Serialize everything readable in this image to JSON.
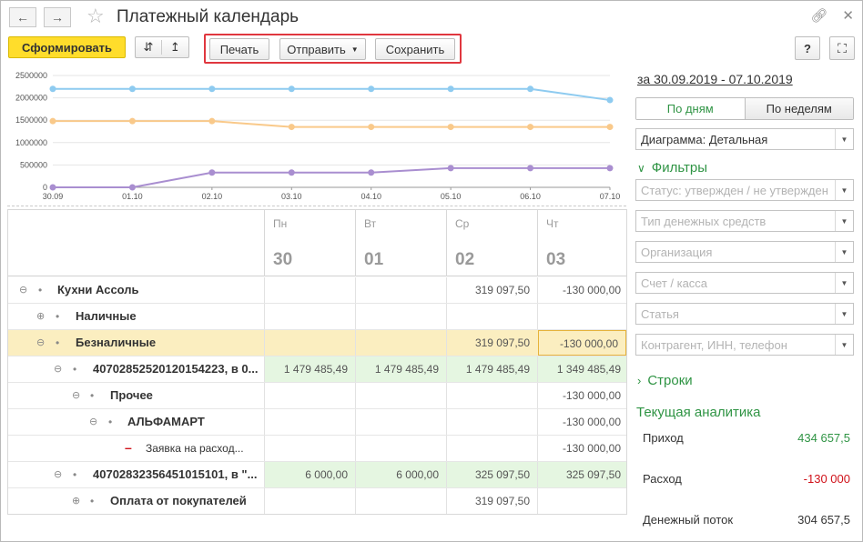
{
  "window": {
    "title": "Платежный календарь",
    "back_icon": "arrow-left-icon",
    "forward_icon": "arrow-right-icon",
    "favorite_icon": "star-icon"
  },
  "toolbar": {
    "generate_label": "Сформировать",
    "print_label": "Печать",
    "send_label": "Отправить",
    "save_label": "Сохранить",
    "help_label": "?"
  },
  "chart_data": {
    "type": "line",
    "x": [
      "30.09",
      "01.10",
      "02.10",
      "03.10",
      "04.10",
      "05.10",
      "06.10",
      "07.10"
    ],
    "yticks": [
      "2500000",
      "2000000",
      "1500000",
      "1000000",
      "500000",
      "0"
    ],
    "ylim": [
      0,
      2500000
    ],
    "series": [
      {
        "color": "#8ecbf0",
        "values": [
          2200000,
          2200000,
          2200000,
          2200000,
          2200000,
          2200000,
          2200000,
          1950000
        ]
      },
      {
        "color": "#f9c98a",
        "values": [
          1480000,
          1480000,
          1480000,
          1350000,
          1350000,
          1350000,
          1350000,
          1350000
        ]
      },
      {
        "color": "#a98ed0",
        "values": [
          0,
          0,
          330000,
          330000,
          330000,
          430000,
          430000,
          430000
        ]
      }
    ]
  },
  "table": {
    "columns": [
      {
        "day": "Пн",
        "date": "30"
      },
      {
        "day": "Вт",
        "date": "01"
      },
      {
        "day": "Ср",
        "date": "02"
      },
      {
        "day": "Чт",
        "date": "03"
      }
    ],
    "rows": [
      {
        "label": "Кухни Ассоль",
        "toggle": "⊖",
        "values": [
          "",
          "",
          "319 097,50",
          "-130 000,00"
        ]
      },
      {
        "label": "Наличные",
        "toggle": "⊕",
        "values": [
          "",
          "",
          "",
          ""
        ]
      },
      {
        "label": "Безналичные",
        "toggle": "⊖",
        "values": [
          "",
          "",
          "319 097,50",
          "-130 000,00"
        ]
      },
      {
        "label": "40702852520120154223, в 0...",
        "toggle": "⊖",
        "values": [
          "1 479 485,49",
          "1 479 485,49",
          "1 479 485,49",
          "1 349 485,49"
        ]
      },
      {
        "label": "Прочее",
        "toggle": "⊖",
        "values": [
          "",
          "",
          "",
          "-130 000,00"
        ]
      },
      {
        "label": "АЛЬФАМАРТ",
        "toggle": "⊖",
        "values": [
          "",
          "",
          "",
          "-130 000,00"
        ]
      },
      {
        "label": "Заявка на расход...",
        "toggle": "",
        "values": [
          "",
          "",
          "",
          "-130 000,00"
        ]
      },
      {
        "label": "40702832356451015101, в \"...",
        "toggle": "⊖",
        "values": [
          "6 000,00",
          "6 000,00",
          "325 097,50",
          "325 097,50"
        ]
      },
      {
        "label": "Оплата от покупателей",
        "toggle": "⊕",
        "values": [
          "",
          "",
          "319 097,50",
          ""
        ]
      }
    ]
  },
  "panel": {
    "period": "за 30.09.2019 - 07.10.2019",
    "by_days": "По дням",
    "by_weeks": "По неделям",
    "diagram": "Диаграмма: Детальная",
    "filters_title": "Фильтры",
    "filters": [
      "Статус: утвержден / не утвержден",
      "Тип денежных средств",
      "Организация",
      "Счет / касса",
      "Статья",
      "Контрагент, ИНН, телефон"
    ],
    "rows_title": "Строки",
    "analytics_title": "Текущая аналитика",
    "income_label": "Приход",
    "income_value": "434 657,5",
    "expense_label": "Расход",
    "expense_value": "-130 000",
    "flow_label": "Денежный поток",
    "flow_value": "304 657,5"
  }
}
